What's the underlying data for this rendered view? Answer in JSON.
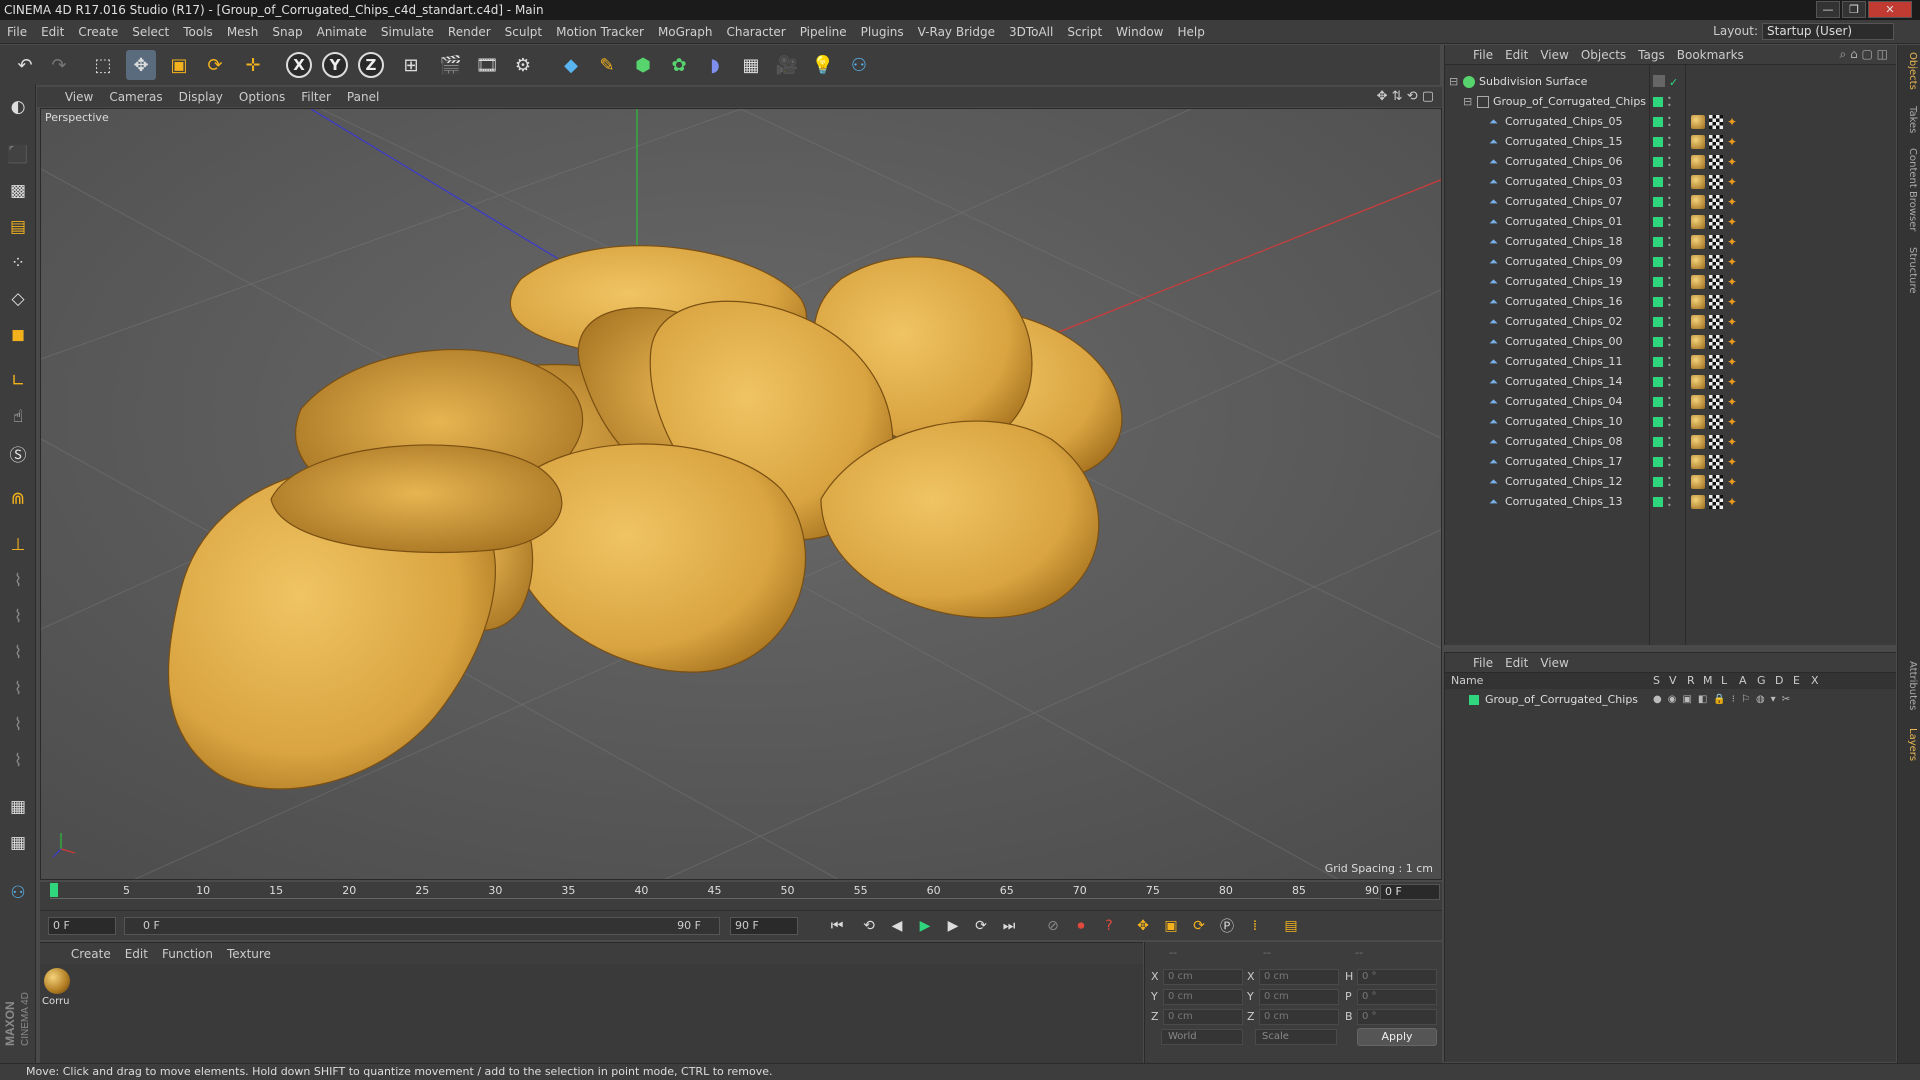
{
  "window": {
    "title": "CINEMA 4D R17.016 Studio (R17) - [Group_of_Corrugated_Chips_c4d_standart.c4d] - Main"
  },
  "menu": [
    "File",
    "Edit",
    "Create",
    "Select",
    "Tools",
    "Mesh",
    "Snap",
    "Animate",
    "Simulate",
    "Render",
    "Sculpt",
    "Motion Tracker",
    "MoGraph",
    "Character",
    "Pipeline",
    "Plugins",
    "V-Ray Bridge",
    "3DToAll",
    "Script",
    "Window",
    "Help"
  ],
  "layout": {
    "label": "Layout:",
    "value": "Startup (User)"
  },
  "viewport": {
    "menu": [
      "View",
      "Cameras",
      "Display",
      "Options",
      "Filter",
      "Panel"
    ],
    "label": "Perspective",
    "grid_spacing": "Grid Spacing : 1 cm"
  },
  "timeline": {
    "ticks": [
      "0",
      "5",
      "10",
      "15",
      "20",
      "25",
      "30",
      "35",
      "40",
      "45",
      "50",
      "55",
      "60",
      "65",
      "70",
      "75",
      "80",
      "85",
      "90"
    ],
    "frame_right": "0 F"
  },
  "transport": {
    "start": "0 F",
    "range_start": "0 F",
    "range_end": "90 F",
    "end": "90 F"
  },
  "material": {
    "menu": [
      "Create",
      "Edit",
      "Function",
      "Texture"
    ],
    "name": "Corru"
  },
  "coords": {
    "header": [
      "--",
      "--",
      "--"
    ],
    "rows": [
      {
        "a": "X",
        "v1": "0 cm",
        "b": "X",
        "v2": "0 cm",
        "c": "H",
        "v3": "0 °"
      },
      {
        "a": "Y",
        "v1": "0 cm",
        "b": "Y",
        "v2": "0 cm",
        "c": "P",
        "v3": "0 °"
      },
      {
        "a": "Z",
        "v1": "0 cm",
        "b": "Z",
        "v2": "0 cm",
        "c": "B",
        "v3": "0 °"
      }
    ],
    "world": "World",
    "scale": "Scale",
    "apply": "Apply"
  },
  "status": "Move: Click and drag to move elements. Hold down SHIFT to quantize movement / add to the selection in point mode, CTRL to remove.",
  "objects": {
    "menu": [
      "File",
      "Edit",
      "View",
      "Objects",
      "Tags",
      "Bookmarks"
    ],
    "root": "Subdivision Surface",
    "group": "Group_of_Corrugated_Chips",
    "items": [
      "Corrugated_Chips_05",
      "Corrugated_Chips_15",
      "Corrugated_Chips_06",
      "Corrugated_Chips_03",
      "Corrugated_Chips_07",
      "Corrugated_Chips_01",
      "Corrugated_Chips_18",
      "Corrugated_Chips_09",
      "Corrugated_Chips_19",
      "Corrugated_Chips_16",
      "Corrugated_Chips_02",
      "Corrugated_Chips_00",
      "Corrugated_Chips_11",
      "Corrugated_Chips_14",
      "Corrugated_Chips_04",
      "Corrugated_Chips_10",
      "Corrugated_Chips_08",
      "Corrugated_Chips_17",
      "Corrugated_Chips_12",
      "Corrugated_Chips_13"
    ]
  },
  "layers": {
    "menu": [
      "File",
      "Edit",
      "View"
    ],
    "columns": [
      "Name",
      "S",
      "V",
      "R",
      "M",
      "L",
      "A",
      "G",
      "D",
      "E",
      "X"
    ],
    "row": "Group_of_Corrugated_Chips"
  },
  "right_tabs": [
    "Objects",
    "Takes",
    "Content Browser",
    "Structure",
    "Attributes",
    "Layers"
  ],
  "colors": {
    "accent": "#2fd67e",
    "chip": "#d9a441",
    "selected_tool": "#5a6b7e"
  }
}
